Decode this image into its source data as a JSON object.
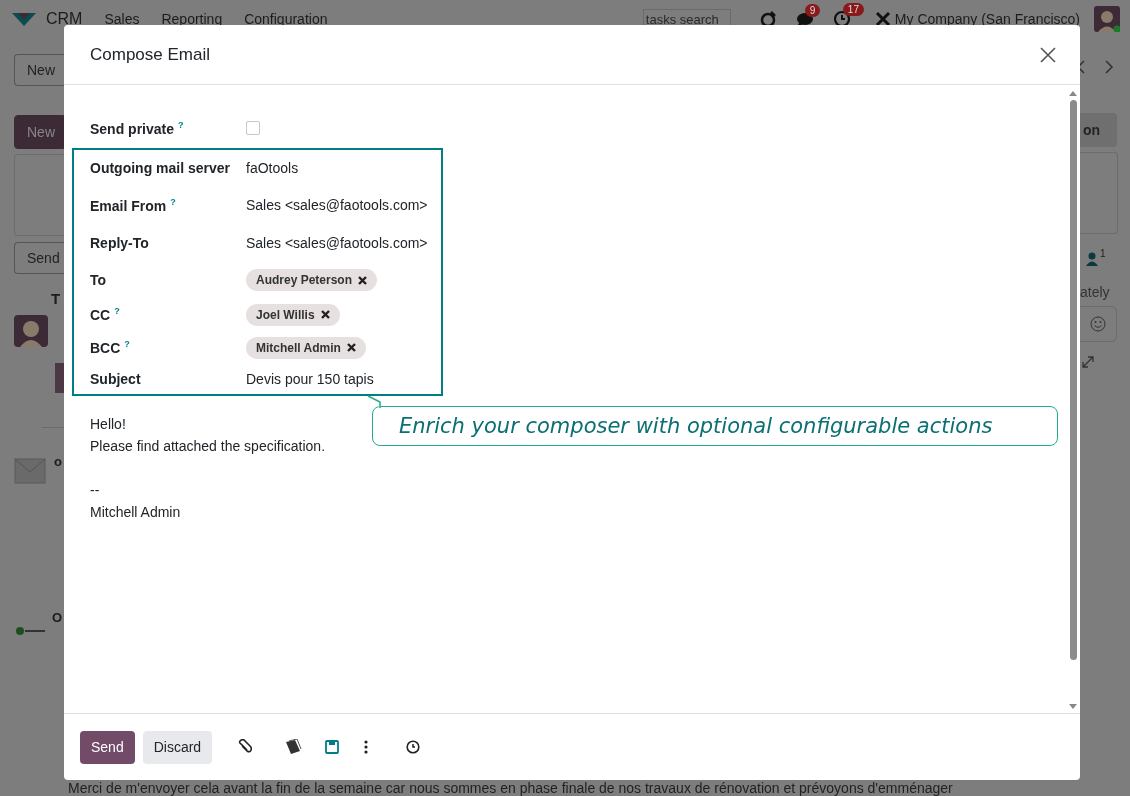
{
  "navbar": {
    "app_name": "CRM",
    "menu": [
      "Sales",
      "Reporting",
      "Configuration"
    ],
    "search": {
      "placeholder": "tasks search"
    },
    "message_count": "9",
    "activity_count": "17",
    "company": "My Company (San Francisco)"
  },
  "background": {
    "new_button": "New",
    "primary_button": "New",
    "send_button": "Send",
    "fragment_left": "T",
    "author_1": "o",
    "author_2": "O",
    "right_button": "on",
    "follower_count": "1",
    "fragment_right": "ately",
    "message_text": "Merci de m'envoyer cela avant la fin de la semaine car nous sommes en phase finale de nos travaux de rénovation et prévoyons d'emménager"
  },
  "dialog": {
    "title": "Compose Email",
    "fields": [
      {
        "kind": "checkbox",
        "label": "Send private",
        "help": "?",
        "checked": false
      }
    ],
    "highlighted_fields": [
      {
        "kind": "text",
        "label": "Outgoing mail server",
        "value": "faOtools"
      },
      {
        "kind": "text",
        "label": "Email From",
        "help": "?",
        "value": "Sales <sales@faotools.com>"
      },
      {
        "kind": "text",
        "label": "Reply-To",
        "value": "Sales <sales@faotools.com>"
      },
      {
        "kind": "tags",
        "label": "To",
        "tags": [
          "Audrey Peterson"
        ]
      },
      {
        "kind": "tags",
        "label": "CC",
        "help": "?",
        "tags": [
          "Joel Willis"
        ]
      },
      {
        "kind": "tags",
        "label": "BCC",
        "help": "?",
        "tags": [
          "Mitchell Admin"
        ]
      },
      {
        "kind": "text",
        "label": "Subject",
        "value": "Devis pour 150 tapis"
      }
    ],
    "body": [
      {
        "lines": [
          "Hello!",
          "Please find attached the specification."
        ]
      },
      {
        "lines": [
          "--",
          "Mitchell Admin"
        ]
      }
    ],
    "tip": "Enrich your composer with optional configurable actions",
    "buttons": [
      {
        "kind": "primary",
        "label": "Send"
      },
      {
        "kind": "secondary",
        "label": "Discard"
      }
    ]
  }
}
